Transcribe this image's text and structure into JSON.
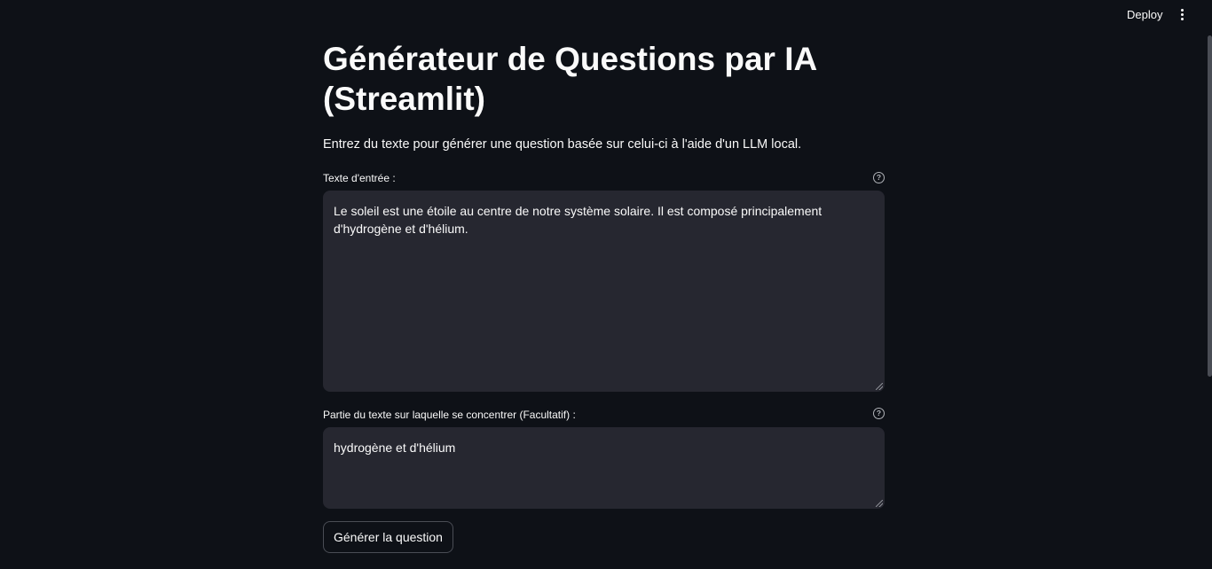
{
  "header": {
    "deploy_label": "Deploy",
    "menu_icon": "vertical-ellipsis-icon"
  },
  "main": {
    "title": "Générateur de Questions par IA (Streamlit)",
    "description": "Entrez du texte pour générer une question basée sur celui-ci à l'aide d'un LLM local.",
    "input_text": {
      "label": "Texte d'entrée :",
      "help_icon": "question-circle-icon",
      "value": "Le soleil est une étoile au centre de notre système solaire. Il est composé principalement d'hydrogène et d'hélium."
    },
    "focus_text": {
      "label": "Partie du texte sur laquelle se concentrer (Facultatif) :",
      "help_icon": "question-circle-icon",
      "value": "hydrogène et d'hélium"
    },
    "generate_button": "Générer la question"
  },
  "colors": {
    "background": "#0e1117",
    "input_bg": "#262730",
    "text": "#fafafa"
  }
}
